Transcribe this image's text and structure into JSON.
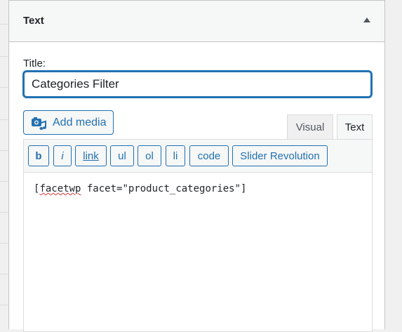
{
  "widget": {
    "title": "Text",
    "field_label": "Title:",
    "title_value": "Categories Filter"
  },
  "media": {
    "add_label": "Add media",
    "icon": "media-camera-music-icon"
  },
  "tabs": [
    {
      "label": "Visual",
      "active": false
    },
    {
      "label": "Text",
      "active": true
    }
  ],
  "quicktags": [
    "b",
    "i",
    "link",
    "ul",
    "ol",
    "li",
    "code",
    "Slider Revolution"
  ],
  "editor": {
    "content_prefix": "[",
    "misspelled": "facetwp",
    "content_suffix": " facet=\"product_categories\"]"
  },
  "colors": {
    "accent": "#2271b1",
    "border": "#c3c4c7",
    "spellcheck": "#d63638"
  }
}
